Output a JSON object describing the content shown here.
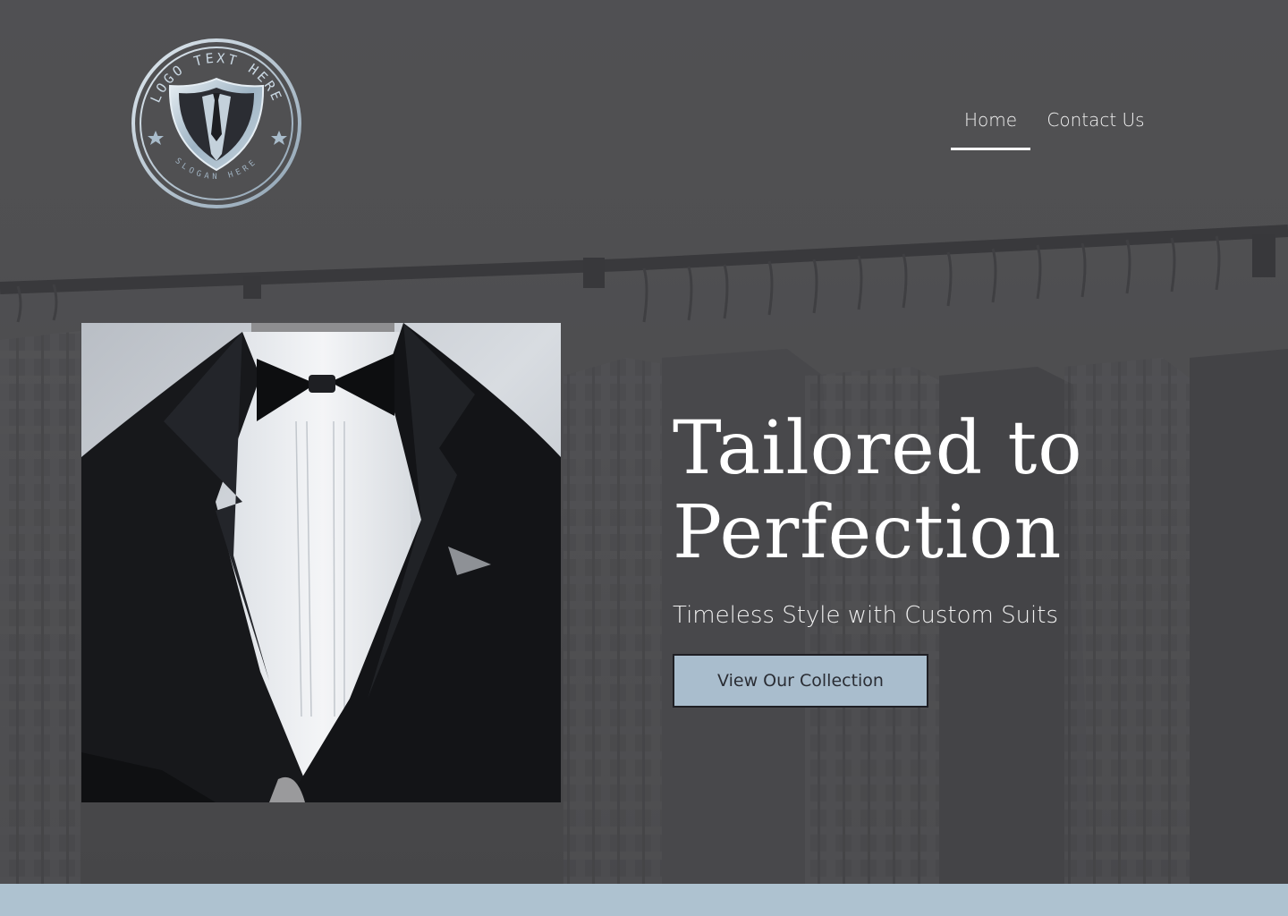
{
  "logo": {
    "ring_text_top": "LOGO TEXT HERE",
    "ring_text_bottom": "SLOGAN HERE",
    "icon": "suit-shield-icon"
  },
  "nav": {
    "items": [
      {
        "label": "Home",
        "active": true
      },
      {
        "label": "Contact Us",
        "active": false
      }
    ]
  },
  "hero": {
    "headline_line1": "Tailored to",
    "headline_line2": "Perfection",
    "subheadline": "Timeless Style with Custom Suits",
    "cta_label": "View Our Collection"
  },
  "colors": {
    "background": "#535355",
    "accent": "#a9bdcd",
    "footer_strip": "#aec2d0",
    "text": "#ffffff"
  }
}
